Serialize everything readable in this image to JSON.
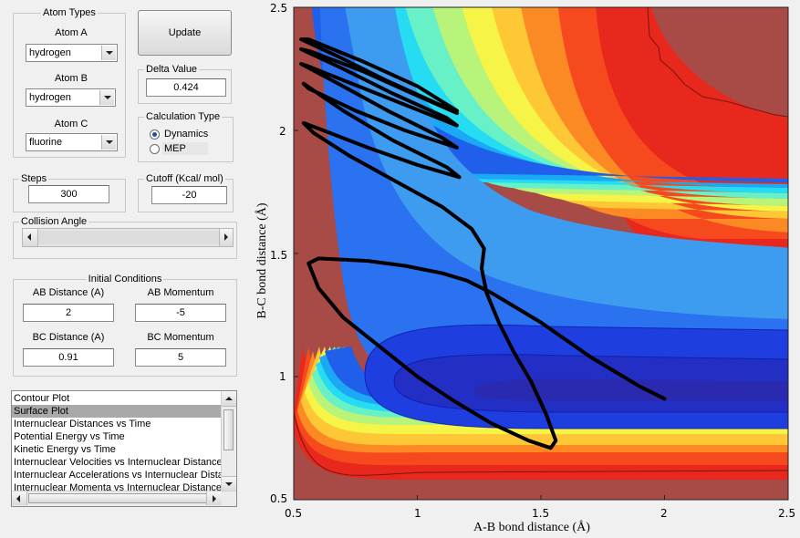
{
  "atom_types": {
    "title": "Atom Types",
    "atom_a": {
      "label": "Atom A",
      "value": "hydrogen"
    },
    "atom_b": {
      "label": "Atom B",
      "value": "hydrogen"
    },
    "atom_c": {
      "label": "Atom C",
      "value": "fluorine"
    }
  },
  "update_label": "Update",
  "delta": {
    "title": "Delta Value",
    "value": "0.424"
  },
  "calc_type": {
    "title": "Calculation Type",
    "options": [
      {
        "label": "Dynamics",
        "selected": true
      },
      {
        "label": "MEP",
        "selected": false
      }
    ]
  },
  "steps": {
    "title": "Steps",
    "value": "300"
  },
  "cutoff": {
    "title": "Cutoff (Kcal/ mol)",
    "value": "-20"
  },
  "collision_angle": {
    "title": "Collision Angle"
  },
  "initial_conditions": {
    "title": "Initial Conditions",
    "ab_distance": {
      "label": "AB Distance (A)",
      "value": "2"
    },
    "ab_momentum": {
      "label": "AB Momentum",
      "value": "-5"
    },
    "bc_distance": {
      "label": "BC Distance (A)",
      "value": "0.91"
    },
    "bc_momentum": {
      "label": "BC Momentum",
      "value": "5"
    }
  },
  "plot_list": {
    "items": [
      "Contour Plot",
      "Surface Plot",
      "Internuclear Distances vs Time",
      "Potential Energy vs Time",
      "Kinetic Energy vs Time",
      "Internuclear Velocities vs Internuclear Distance",
      "Internuclear Accelerations vs Internuclear Distance",
      "Internuclear Momenta vs Internuclear Distance"
    ],
    "selected_index": 1
  },
  "chart_data": {
    "type": "heatmap",
    "xlabel": "A-B bond distance (Å)",
    "ylabel": "B-C bond distance (Å)",
    "xlim": [
      0.5,
      2.5
    ],
    "ylim": [
      0.5,
      2.5
    ],
    "x_ticks": [
      "0.5",
      "1",
      "1.5",
      "2",
      "2.5"
    ],
    "y_ticks": [
      "0.5",
      "1",
      "1.5",
      "2",
      "2.5"
    ],
    "colormap": [
      "#00008f",
      "#0000ff",
      "#00ffff",
      "#ffff00",
      "#ff0000",
      "#800000"
    ],
    "trajectory_color": "#000000",
    "trajectory": [
      [
        2.0,
        0.91
      ],
      [
        1.9,
        0.96
      ],
      [
        1.8,
        1.02
      ],
      [
        1.7,
        1.08
      ],
      [
        1.6,
        1.15
      ],
      [
        1.5,
        1.22
      ],
      [
        1.4,
        1.28
      ],
      [
        1.3,
        1.34
      ],
      [
        1.2,
        1.39
      ],
      [
        1.1,
        1.42
      ],
      [
        0.95,
        1.45
      ],
      [
        0.8,
        1.47
      ],
      [
        0.6,
        1.48
      ],
      [
        0.56,
        1.46
      ],
      [
        0.6,
        1.36
      ],
      [
        0.7,
        1.24
      ],
      [
        0.85,
        1.12
      ],
      [
        1.0,
        1.0
      ],
      [
        1.15,
        0.9
      ],
      [
        1.3,
        0.81
      ],
      [
        1.45,
        0.74
      ],
      [
        1.54,
        0.71
      ],
      [
        1.56,
        0.74
      ],
      [
        1.52,
        0.85
      ],
      [
        1.46,
        0.98
      ],
      [
        1.39,
        1.1
      ],
      [
        1.33,
        1.22
      ],
      [
        1.28,
        1.34
      ],
      [
        1.26,
        1.44
      ],
      [
        1.27,
        1.52
      ],
      [
        1.22,
        1.6
      ],
      [
        1.1,
        1.69
      ],
      [
        0.9,
        1.8
      ],
      [
        0.72,
        1.9
      ],
      [
        0.58,
        1.99
      ],
      [
        0.54,
        2.03
      ],
      [
        0.62,
        2.0
      ],
      [
        0.8,
        1.93
      ],
      [
        1.0,
        1.86
      ],
      [
        1.17,
        1.81
      ],
      [
        1.12,
        1.85
      ],
      [
        0.9,
        1.96
      ],
      [
        0.7,
        2.08
      ],
      [
        0.54,
        2.19
      ],
      [
        0.56,
        2.17
      ],
      [
        0.75,
        2.08
      ],
      [
        0.95,
        2.0
      ],
      [
        1.16,
        1.93
      ],
      [
        1.1,
        1.97
      ],
      [
        0.88,
        2.08
      ],
      [
        0.68,
        2.19
      ],
      [
        0.53,
        2.27
      ],
      [
        0.56,
        2.26
      ],
      [
        0.76,
        2.18
      ],
      [
        0.96,
        2.1
      ],
      [
        1.16,
        2.02
      ],
      [
        1.12,
        2.05
      ],
      [
        0.9,
        2.15
      ],
      [
        0.7,
        2.25
      ],
      [
        0.53,
        2.33
      ],
      [
        0.57,
        2.32
      ],
      [
        0.78,
        2.24
      ],
      [
        0.98,
        2.15
      ],
      [
        1.16,
        2.07
      ],
      [
        1.1,
        2.1
      ],
      [
        0.88,
        2.2
      ],
      [
        0.68,
        2.3
      ],
      [
        0.53,
        2.37
      ],
      [
        0.56,
        2.37
      ],
      [
        0.78,
        2.28
      ],
      [
        1.0,
        2.18
      ],
      [
        1.16,
        2.08
      ]
    ]
  }
}
